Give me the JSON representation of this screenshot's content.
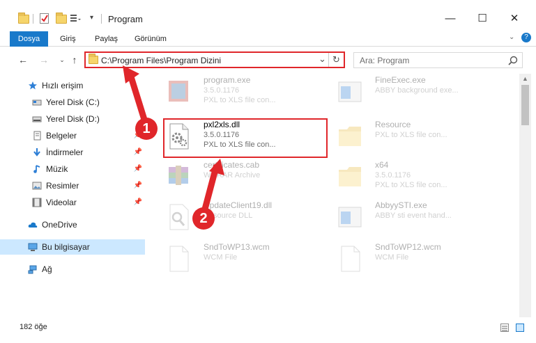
{
  "window": {
    "title": "Program",
    "minimize": "—",
    "maximize": "☐",
    "close": "✕"
  },
  "ribbon": {
    "tabs": [
      "Dosya",
      "Giriş",
      "Paylaş",
      "Görünüm"
    ],
    "help": "?"
  },
  "address": {
    "path": "C:\\Program Files\\Program Dizini",
    "dropdown": "⌄",
    "refresh": "↻"
  },
  "search": {
    "placeholder": "Ara: Program",
    "icon": "magnifier-icon"
  },
  "nav": {
    "items": [
      {
        "label": "Hızlı erişim",
        "icon": "star-icon",
        "pinned": false
      },
      {
        "label": "Yerel Disk (C:)",
        "icon": "drive-icon",
        "pinned": false
      },
      {
        "label": "Yerel Disk (D:)",
        "icon": "drive-icon",
        "pinned": false
      },
      {
        "label": "Belgeler",
        "icon": "documents-icon",
        "pinned": true
      },
      {
        "label": "İndirmeler",
        "icon": "download-icon",
        "pinned": true
      },
      {
        "label": "Müzik",
        "icon": "music-icon",
        "pinned": true
      },
      {
        "label": "Resimler",
        "icon": "pictures-icon",
        "pinned": true
      },
      {
        "label": "Videolar",
        "icon": "video-icon",
        "pinned": true
      },
      {
        "label": "OneDrive",
        "icon": "cloud-icon",
        "pinned": false
      },
      {
        "label": "Bu bilgisayar",
        "icon": "computer-icon",
        "pinned": false,
        "selected": true
      },
      {
        "label": "Ağ",
        "icon": "network-icon",
        "pinned": false
      }
    ]
  },
  "files": [
    {
      "name": "program.exe",
      "version": "3.5.0.1176",
      "desc": "PXL to XLS file con...",
      "icon": "exe-icon",
      "faded": true
    },
    {
      "name": "FineExec.exe",
      "version": "ABBY background exe...",
      "desc": "",
      "icon": "window-icon",
      "faded": true
    },
    {
      "name": "pxl2xls.dll",
      "version": "3.5.0.1176",
      "desc": "PXL to XLS file con...",
      "icon": "dll-gear-icon",
      "faded": false,
      "highlighted": true
    },
    {
      "name": "Resource",
      "version": "PXL to XLS file con...",
      "desc": "",
      "icon": "folder-icon",
      "faded": true
    },
    {
      "name": "certificates.cab",
      "version": "WinRAR Archive",
      "desc": "",
      "icon": "winrar-icon",
      "faded": true
    },
    {
      "name": "x64",
      "version": "3.5.0.1176",
      "desc": "PXL to XLS file con...",
      "icon": "folder-icon",
      "faded": true
    },
    {
      "name": "UpdateClient19.dll",
      "version": "Resource DLL",
      "desc": "",
      "icon": "dll-search-icon",
      "faded": true
    },
    {
      "name": "AbbyySTI.exe",
      "version": "ABBY sti event hand...",
      "desc": "",
      "icon": "window-icon",
      "faded": true
    },
    {
      "name": "SndToWP13.wcm",
      "version": "WCM File",
      "desc": "",
      "icon": "blank-file-icon",
      "faded": true
    },
    {
      "name": "SndToWP12.wcm",
      "version": "WCM File",
      "desc": "",
      "icon": "blank-file-icon",
      "faded": true
    }
  ],
  "annotations": {
    "step1": "1",
    "step2": "2",
    "color": "#e0262a"
  },
  "status": {
    "count": "182 öğe"
  }
}
